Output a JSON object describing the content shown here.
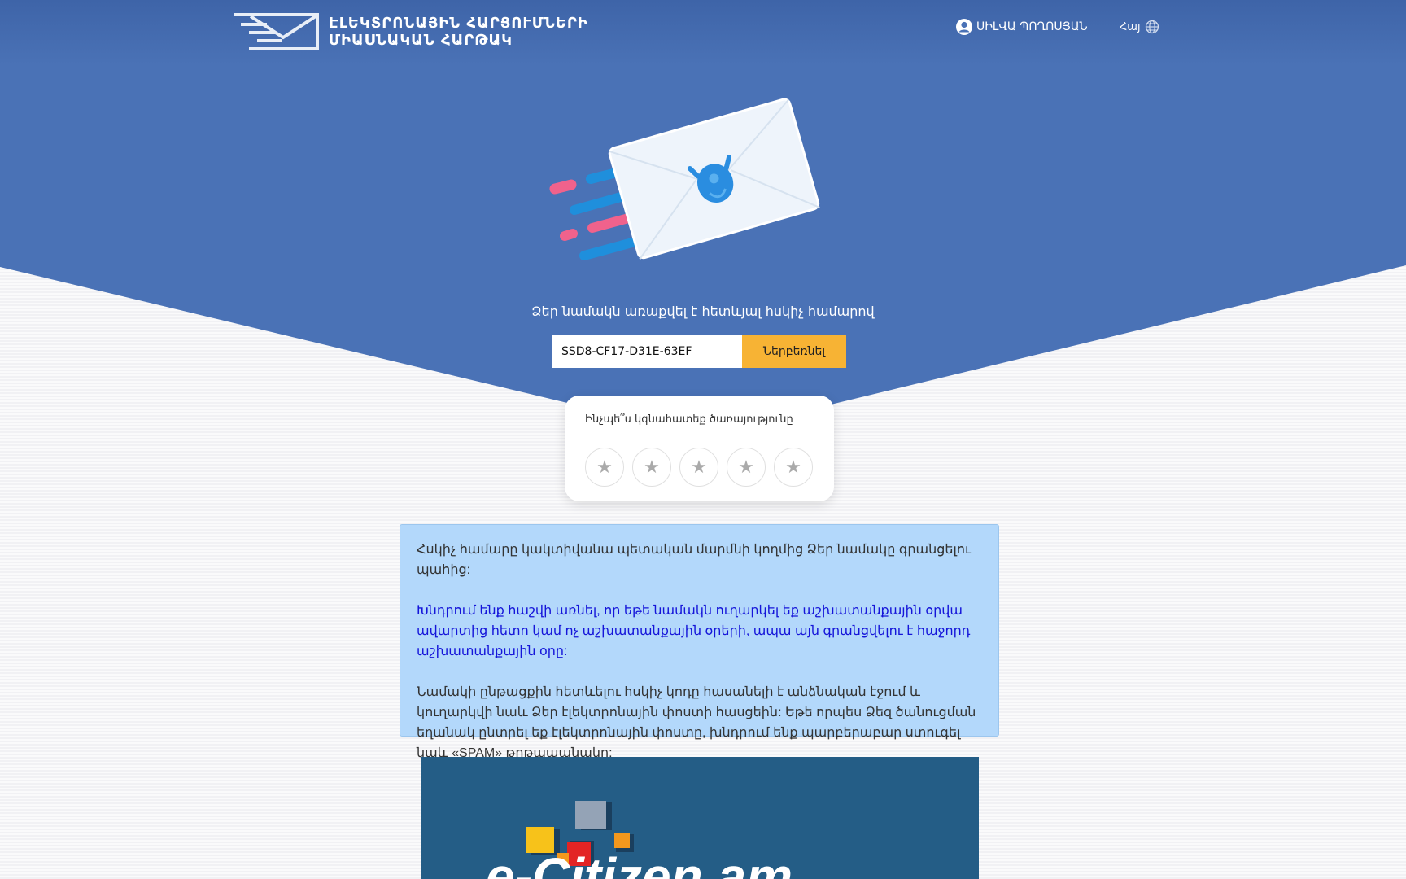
{
  "header": {
    "logo_line1": "ԷԼԵԿՏՐՈՆԱՅԻՆ ՀԱՐՑՈՒՄՆԵՐԻ",
    "logo_line2": "ՄԻԱՍՆԱԿԱՆ ՀԱՐԹԱԿ",
    "user_name": "ՍԻԼՎԱ ՊՈՂՈՍՅԱՆ",
    "language": "Հայ"
  },
  "tracking": {
    "label": "Ձեր նամակն առաքվել է հետևյալ հսկիչ համարով",
    "code": "SSD8-CF17-D31E-63EF",
    "button": "Ներբեռնել"
  },
  "rating": {
    "title": "Ինչպե՞ս կգնահատեք ծառայությունը",
    "stars": [
      "★",
      "★",
      "★",
      "★",
      "★"
    ],
    "max_stars": 5,
    "selected": 0
  },
  "info": {
    "paragraph1": "Հսկիչ համարը կակտիվանա պետական մարմնի կողմից Ձեր նամակը գրանցելու պահից:",
    "paragraph2": "Խնդրում ենք հաշվի առնել, որ եթե նամակն ուղարկել եք աշխատանքային օրվա ավարտից հետո կամ ոչ աշխատանքային օրերի, ապա այն գրանցվելու է հաջորդ աշխատանքային օրը:",
    "paragraph3": "Նամակի ընթացքին հետևելու հսկիչ կոդը հասանելի է անձնական էջում և կուղարկվի նաև Ձեր էլեկտրոնային փոստի հասցեին: Եթե որպես Ձեզ ծանուցման եղանակ ընտրել եք էլեկտրոնային փոստը, խնդրում ենք պարբերաբար ստուգել նաև «SPAM» թղթապանակը:"
  },
  "banner": {
    "text": "e-Citizen.am"
  },
  "colors": {
    "header_blue": "#4a72b6",
    "accent_orange": "#f7b334",
    "info_bg": "#b3d8fb",
    "highlight_text": "#1515d9",
    "banner_bg": "#245d86"
  }
}
